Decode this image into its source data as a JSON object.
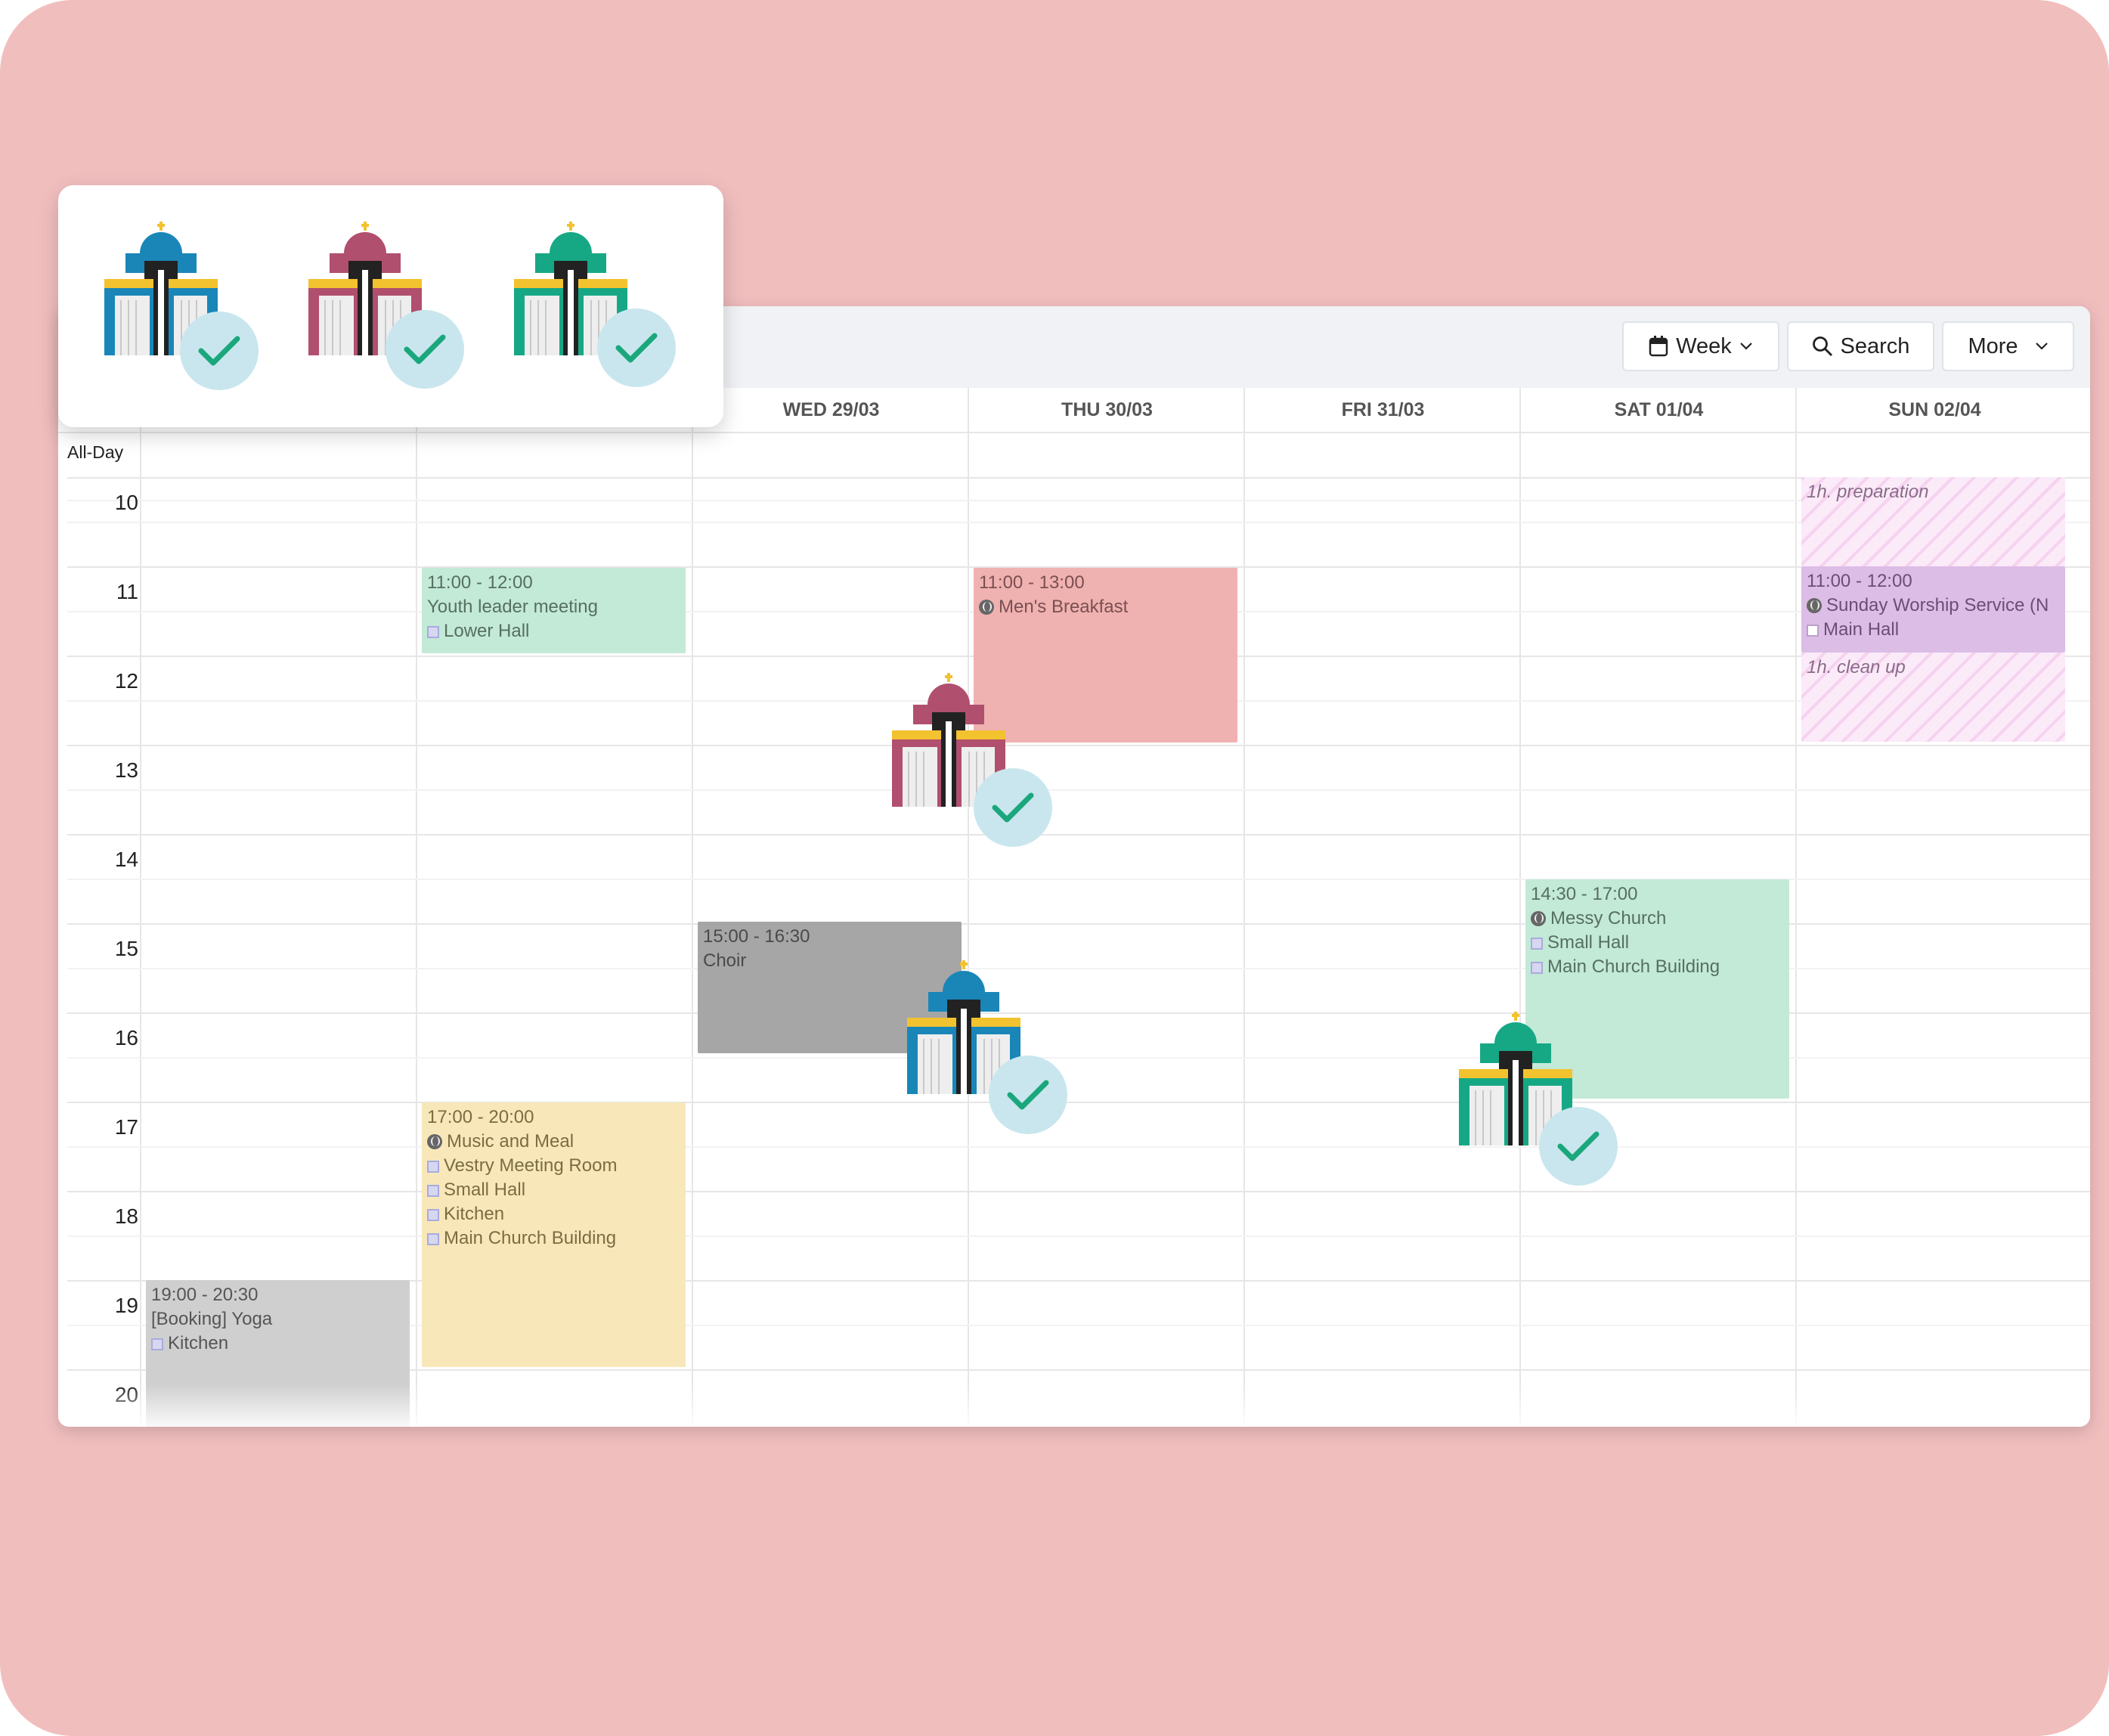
{
  "toolbar": {
    "view_label": "Week",
    "search_label": "Search",
    "more_label": "More"
  },
  "calendar": {
    "all_day_label": "All-Day",
    "days": [
      {
        "label": ""
      },
      {
        "label": ""
      },
      {
        "label": "WED 29/03"
      },
      {
        "label": "THU 30/03"
      },
      {
        "label": "FRI 31/03"
      },
      {
        "label": "SAT 01/04"
      },
      {
        "label": "SUN 02/04"
      }
    ],
    "hours": [
      "10",
      "11",
      "12",
      "13",
      "14",
      "15",
      "16",
      "17",
      "18",
      "19",
      "20"
    ]
  },
  "events": {
    "youth": {
      "time": "11:00 - 12:00",
      "title": "Youth leader meeting",
      "resources": [
        "Lower Hall"
      ],
      "color": "#c3e9d7"
    },
    "mens": {
      "time": "11:00 - 13:00",
      "title": "Men's Breakfast",
      "color": "#f0b1b1"
    },
    "prep": {
      "title": "1h. preparation"
    },
    "worship": {
      "time": "11:00 - 12:00",
      "title": "Sunday Worship Service (N",
      "resources": [
        "Main Hall"
      ],
      "color": "#dcbde6"
    },
    "cleanup": {
      "title": "1h. clean up"
    },
    "choir": {
      "time": "15:00 - 16:30",
      "title": "Choir",
      "color": "#a6a6a6"
    },
    "messy": {
      "time": "14:30 - 17:00",
      "title": "Messy Church",
      "resources": [
        "Small Hall",
        "Main Church Building"
      ],
      "color": "#c3e9d7"
    },
    "music": {
      "time": "17:00 - 20:00",
      "title": "Music and Meal",
      "resources": [
        "Vestry Meeting Room",
        "Small Hall",
        "Kitchen",
        "Main Church Building"
      ],
      "color": "#f8e8b9"
    },
    "yoga": {
      "time": "19:00 - 20:30",
      "title": "[Booking] Yoga",
      "resources": [
        "Kitchen"
      ],
      "color": "#cfcfcf"
    }
  },
  "colors": {
    "background": "#f1bebe",
    "church_blue": "#1a86b8",
    "church_maroon": "#b14f6e",
    "church_green": "#16a884",
    "church_roof": "#f2c22f",
    "check_green": "#1aa77c",
    "check_badge": "#c9e6ee"
  },
  "icons": [
    "calendar-icon",
    "search-icon",
    "chevron-down-icon",
    "globe-icon",
    "church-icon",
    "checkmark-icon"
  ]
}
